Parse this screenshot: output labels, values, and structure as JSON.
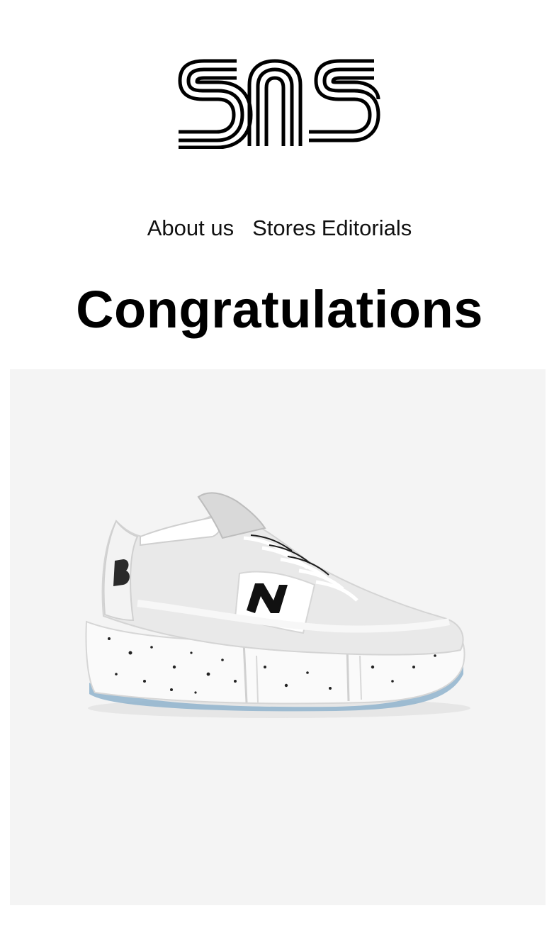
{
  "brand": {
    "logo_text": "SNS",
    "logo_icon": "sns-logo-icon"
  },
  "nav": {
    "items": [
      {
        "label": "About us"
      },
      {
        "label": "Stores"
      },
      {
        "label": "Editorials"
      }
    ]
  },
  "hero": {
    "title": "Congratulations",
    "image_icon": "sneaker-image",
    "panel_color": "#f4f4f4"
  },
  "colors": {
    "background": "#ffffff",
    "text": "#000000",
    "sole_accent": "#8fb3cc"
  }
}
